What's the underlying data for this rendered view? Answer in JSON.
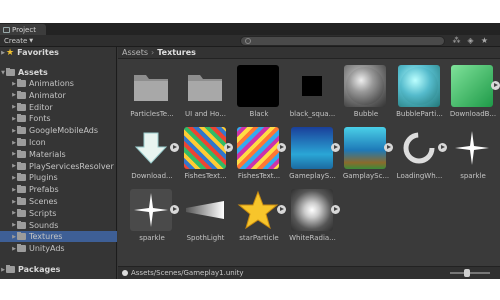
{
  "window": {
    "tab_label": "Project"
  },
  "toolbar": {
    "create_label": "Create",
    "search_placeholder": ""
  },
  "sidebar": {
    "favorites": "Favorites",
    "assets": "Assets",
    "packages": "Packages",
    "folders": [
      "Animations",
      "Animator",
      "Editor",
      "Fonts",
      "GoogleMobileAds",
      "Icon",
      "Materials",
      "PlayServicesResolver",
      "Plugins",
      "Prefabs",
      "Scenes",
      "Scripts",
      "Sounds",
      "Textures",
      "UnityAds"
    ],
    "selected": "Textures"
  },
  "breadcrumb": {
    "root": "Assets",
    "current": "Textures"
  },
  "assets": [
    {
      "name": "ParticlesTe..."
    },
    {
      "name": "UI and Ho..."
    },
    {
      "name": "Black"
    },
    {
      "name": "black_squa..."
    },
    {
      "name": "Bubble"
    },
    {
      "name": "BubbleParti..."
    },
    {
      "name": "DownloadB..."
    },
    {
      "name": "Download..."
    },
    {
      "name": "FishesText..."
    },
    {
      "name": "FishesText..."
    },
    {
      "name": "GameplayS..."
    },
    {
      "name": "GamplaySc..."
    },
    {
      "name": "LoadingWh..."
    },
    {
      "name": "sparkle"
    },
    {
      "name": "sparkle"
    },
    {
      "name": "SpothLight"
    },
    {
      "name": "starParticle"
    },
    {
      "name": "WhiteRadia..."
    }
  ],
  "status": {
    "path": "Assets/Scenes/Gameplay1.unity"
  },
  "colors": {
    "selection": "#3e5f96",
    "panel": "#383838",
    "star": "#f2c230"
  }
}
